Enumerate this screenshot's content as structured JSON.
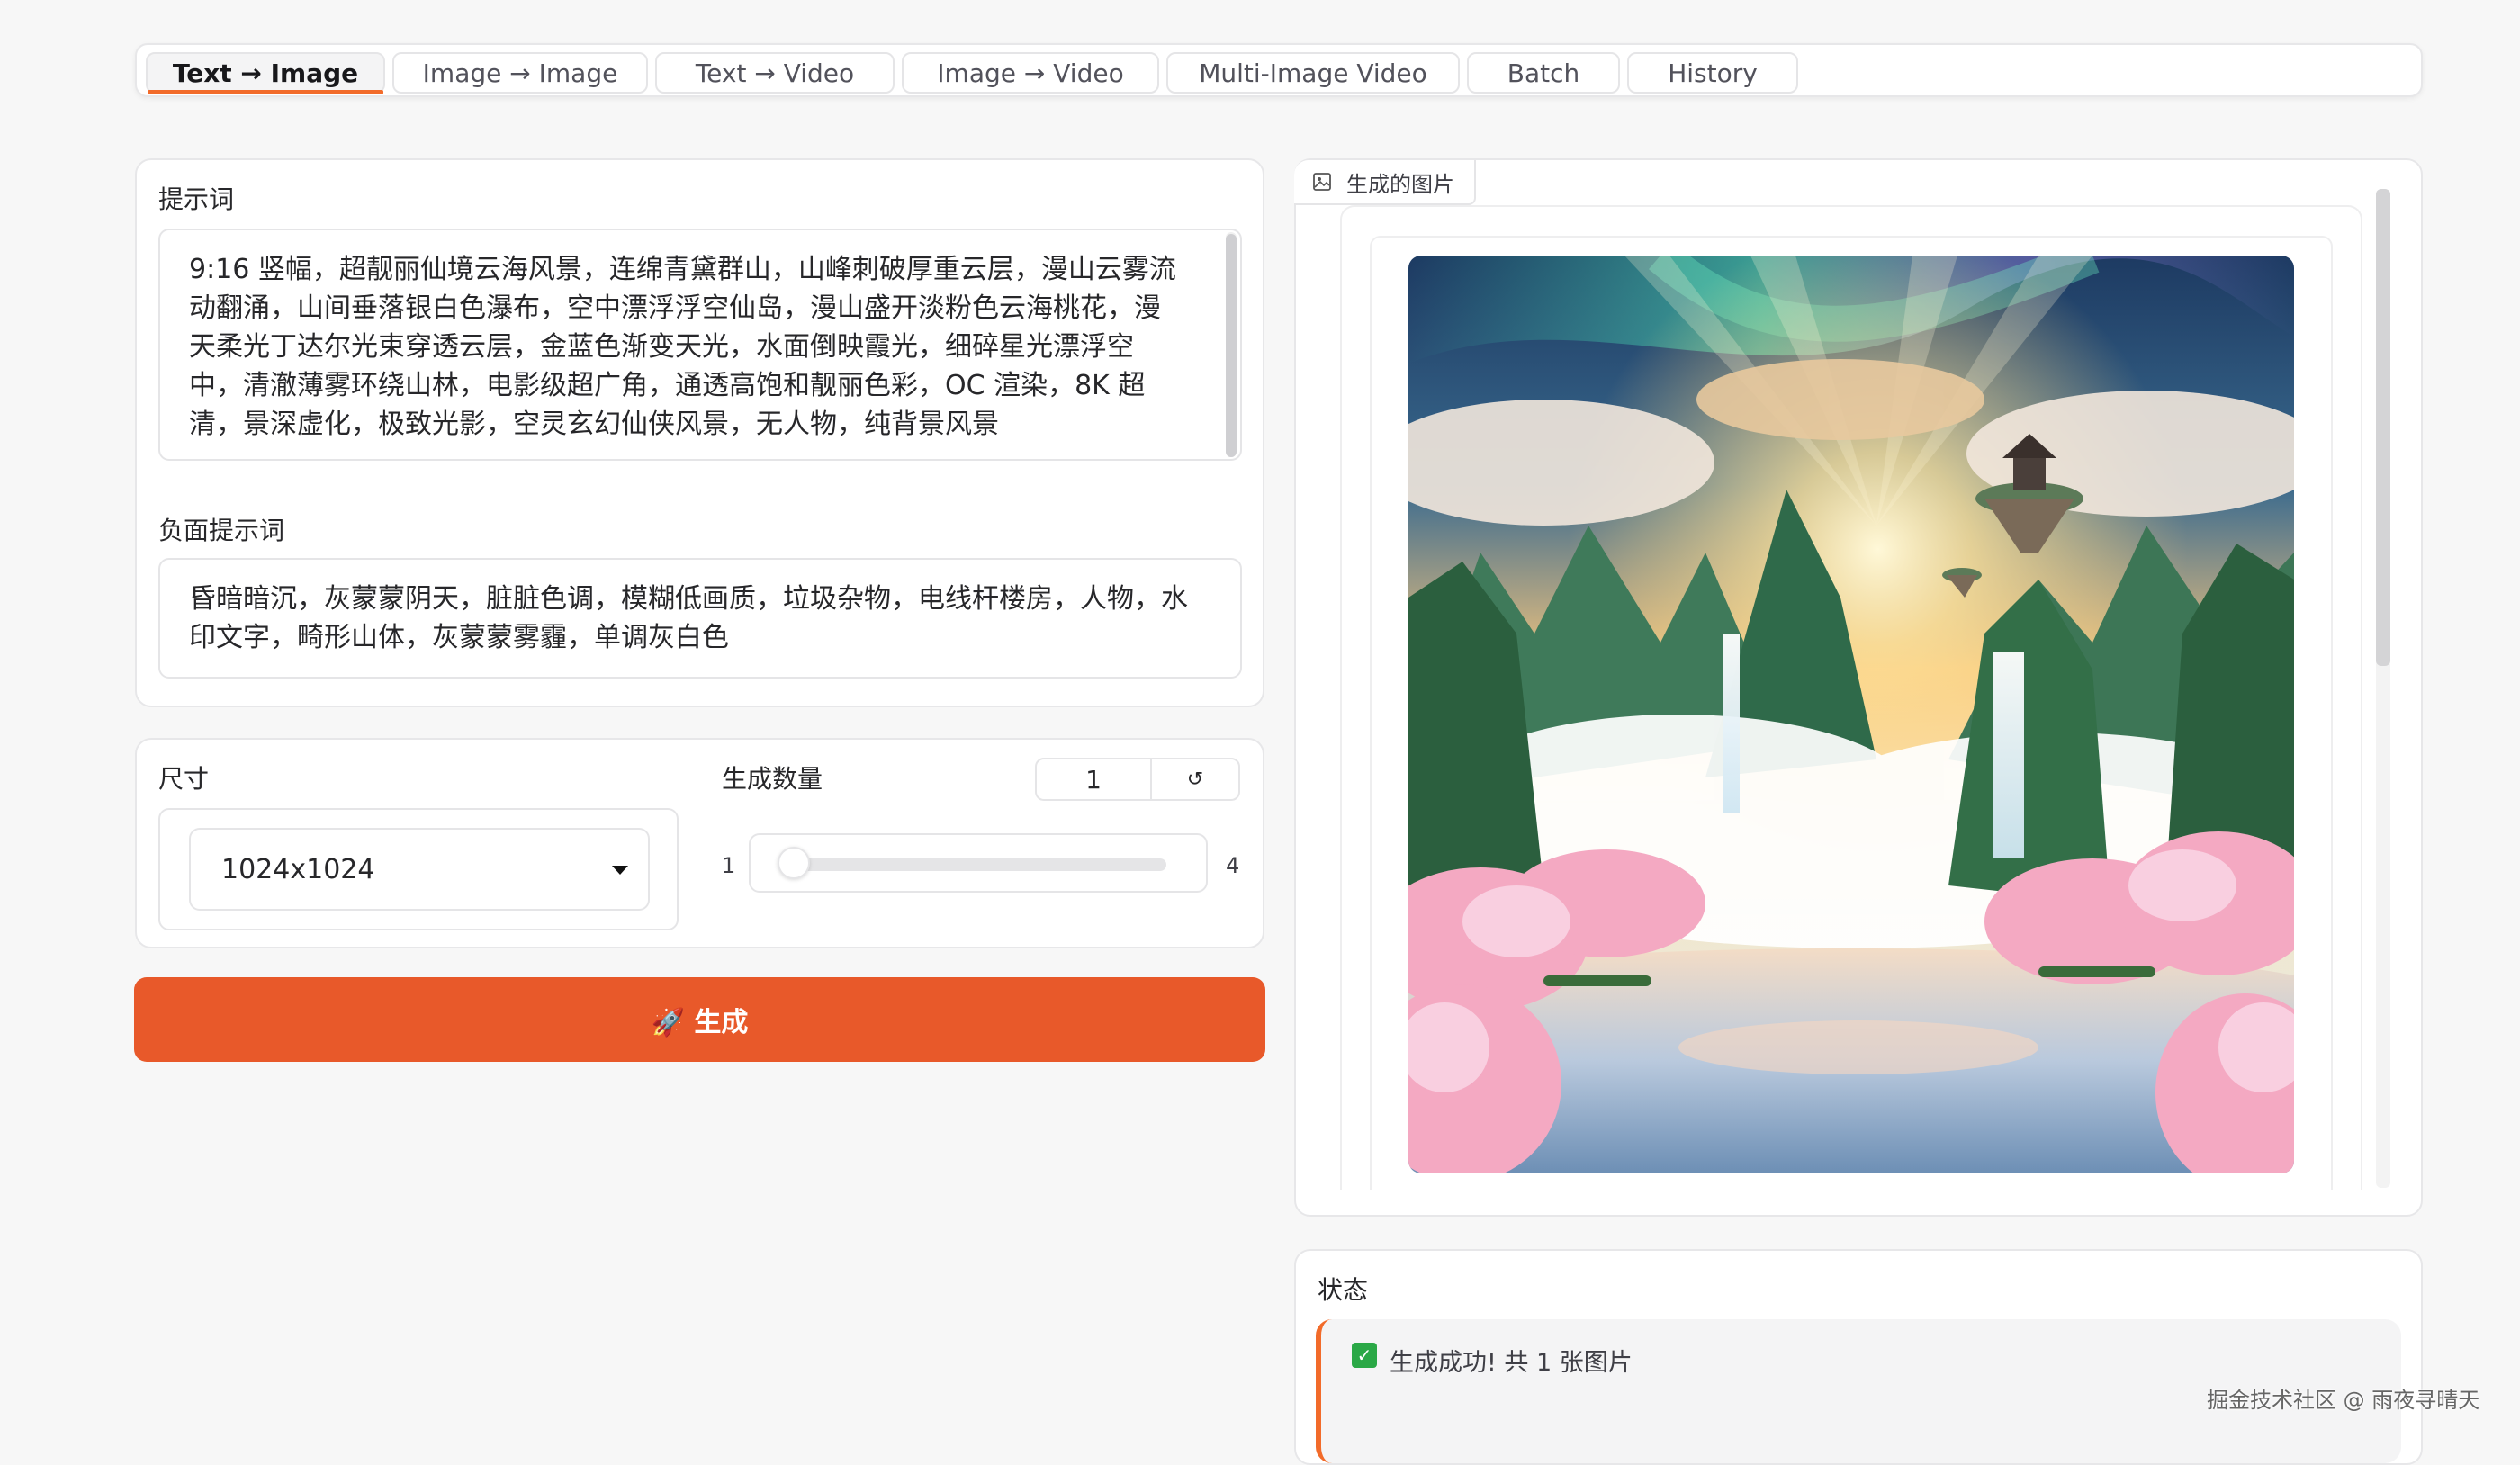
{
  "tabs": [
    {
      "label": "Text → Image",
      "active": true
    },
    {
      "label": "Image → Image",
      "active": false
    },
    {
      "label": "Text → Video",
      "active": false
    },
    {
      "label": "Image → Video",
      "active": false
    },
    {
      "label": "Multi-Image Video",
      "active": false
    },
    {
      "label": "Batch",
      "active": false
    },
    {
      "label": "History",
      "active": false
    }
  ],
  "prompt": {
    "label": "提示词",
    "value": "9:16 竖幅，超靓丽仙境云海风景，连绵青黛群山，山峰刺破厚重云层，漫山云雾流动翻涌，山间垂落银白色瀑布，空中漂浮浮空仙岛，漫山盛开淡粉色云海桃花，漫天柔光丁达尔光束穿透云层，金蓝色渐变天光，水面倒映霞光，细碎星光漂浮空中，清澈薄雾环绕山林，电影级超广角，通透高饱和靓丽色彩，OC 渲染，8K 超清，景深虚化，极致光影，空灵玄幻仙侠风景，无人物，纯背景风景"
  },
  "negative_prompt": {
    "label": "负面提示词",
    "value": "昏暗暗沉，灰蒙蒙阴天，脏脏色调，模糊低画质，垃圾杂物，电线杆楼房，人物，水印文字，畸形山体，灰蒙蒙雾霾，单调灰白色"
  },
  "size": {
    "label": "尺寸",
    "selected": "1024x1024"
  },
  "count": {
    "label": "生成数量",
    "value": "1",
    "reset_icon": "↺",
    "min": "1",
    "max": "4",
    "fraction": 0
  },
  "generate_button": {
    "label": "🚀 生成"
  },
  "output": {
    "tab_label": "生成的图片",
    "tab_icon": "image-icon"
  },
  "status": {
    "label": "状态",
    "icon": "✅",
    "message": "生成成功! 共 1 张图片"
  },
  "watermark": "掘金技术社区 @ 雨夜寻晴天",
  "colors": {
    "accent": "#e8592a",
    "tab_underline": "#f26b2a"
  }
}
